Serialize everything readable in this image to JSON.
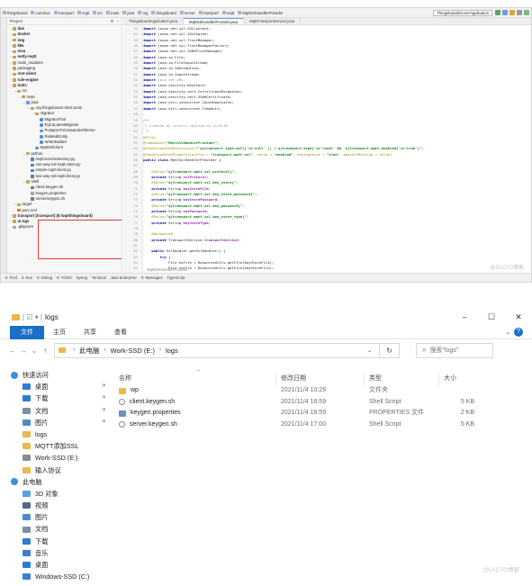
{
  "ide": {
    "breadcrumbs": [
      "thingsboard",
      "common",
      "transport",
      "mqtt",
      "src",
      "main",
      "java",
      "org",
      "thingsboard",
      "server",
      "transport",
      "mqtt",
      "MqttSslHandlerProvider"
    ],
    "run_config": "ThingsboardServerApplication",
    "project_label": "Project",
    "tabs": [
      "ThingsboardApplication.java",
      "MqttSslHandlerProvider.java",
      "MqttTransportService.java"
    ],
    "tree": [
      {
        "label": "dao",
        "depth": 0,
        "icon": "folder",
        "arrow": "›",
        "bold": true
      },
      {
        "label": "docker",
        "depth": 0,
        "icon": "folder",
        "arrow": "›",
        "bold": true
      },
      {
        "label": "img",
        "depth": 0,
        "icon": "folder",
        "arrow": "›",
        "bold": true
      },
      {
        "label": "k8s",
        "depth": 0,
        "icon": "folder",
        "arrow": "›",
        "bold": true
      },
      {
        "label": "msa",
        "depth": 0,
        "icon": "folder",
        "arrow": "›",
        "bold": true
      },
      {
        "label": "netty-mqtt",
        "depth": 0,
        "icon": "folder",
        "arrow": "›",
        "bold": true
      },
      {
        "label": "node_modules",
        "depth": 0,
        "icon": "folder",
        "arrow": "›",
        "bold": false
      },
      {
        "label": "packaging",
        "depth": 0,
        "icon": "folder",
        "arrow": "›",
        "bold": false
      },
      {
        "label": "rest-client",
        "depth": 0,
        "icon": "folder",
        "arrow": "›",
        "bold": true
      },
      {
        "label": "rule-engine",
        "depth": 0,
        "icon": "folder",
        "arrow": "›",
        "bold": true
      },
      {
        "label": "tools",
        "depth": 0,
        "icon": "folder",
        "arrow": "⌄",
        "bold": true
      },
      {
        "label": "src",
        "depth": 1,
        "icon": "folder",
        "arrow": "⌄",
        "bold": false
      },
      {
        "label": "main",
        "depth": 2,
        "icon": "folder",
        "arrow": "⌄",
        "bold": false
      },
      {
        "label": "java",
        "depth": 3,
        "icon": "src",
        "arrow": "⌄",
        "bold": false
      },
      {
        "label": "org.thingsboard.client.tools",
        "depth": 4,
        "icon": "folder",
        "arrow": "⌄",
        "bold": false
      },
      {
        "label": "migrator",
        "depth": 5,
        "icon": "folder",
        "arrow": "⌄",
        "bold": false
      },
      {
        "label": "MigratorTool",
        "depth": 6,
        "icon": "java",
        "arrow": "",
        "bold": false
      },
      {
        "label": "PgCaLatestMigrator",
        "depth": 6,
        "icon": "java",
        "arrow": "",
        "bold": false
      },
      {
        "label": "PostgresToCassandraTeleme",
        "depth": 6,
        "icon": "java",
        "arrow": "",
        "bold": false
      },
      {
        "label": "RelatedEntity",
        "depth": 6,
        "icon": "java",
        "arrow": "",
        "bold": false
      },
      {
        "label": "WriterBuilder",
        "depth": 6,
        "icon": "java",
        "arrow": "",
        "bold": false
      },
      {
        "label": "MqttSslClient",
        "depth": 5,
        "icon": "java",
        "arrow": "",
        "bold": false
      },
      {
        "label": "python",
        "depth": 3,
        "icon": "folder",
        "arrow": "⌄",
        "bold": false
      },
      {
        "label": "mqtt-send-telemetry.py",
        "depth": 4,
        "icon": "py",
        "arrow": "",
        "bold": false
      },
      {
        "label": "one-way-ssl-mqtt-client.py",
        "depth": 4,
        "icon": "py",
        "arrow": "",
        "bold": false
      },
      {
        "label": "simple-mqtt-client.py",
        "depth": 4,
        "icon": "py",
        "arrow": "",
        "bold": false
      },
      {
        "label": "two-way-ssl-mqtt-client.py",
        "depth": 4,
        "icon": "py",
        "arrow": "",
        "bold": false
      },
      {
        "label": "shell",
        "depth": 3,
        "icon": "folder",
        "arrow": "⌄",
        "bold": false
      },
      {
        "label": "client.keygen.sh",
        "depth": 4,
        "icon": "sh",
        "arrow": "",
        "bold": false
      },
      {
        "label": "keygen.properties",
        "depth": 4,
        "icon": "prop",
        "arrow": "",
        "bold": false
      },
      {
        "label": "server.keygen.sh",
        "depth": 4,
        "icon": "sh",
        "arrow": "",
        "bold": false
      },
      {
        "label": "target",
        "depth": 1,
        "icon": "folder",
        "arrow": "›",
        "bold": false
      },
      {
        "label": "pom.xml",
        "depth": 1,
        "icon": "xml",
        "arrow": "",
        "bold": false
      },
      {
        "label": "transport [transport] (E:\\wp\\thingsboard)",
        "depth": 0,
        "icon": "folder",
        "arrow": "›",
        "bold": true
      },
      {
        "label": "ui-ngx",
        "depth": 0,
        "icon": "folder",
        "arrow": "›",
        "bold": true
      },
      {
        "label": ".gitignore",
        "depth": 0,
        "icon": "prop",
        "arrow": "",
        "bold": false
      }
    ],
    "code_lines": [
      {
        "n": "43",
        "parts": [
          [
            "k",
            "import "
          ],
          [
            "t",
            "javax.net.ssl.SSLContext;"
          ]
        ]
      },
      {
        "n": "44",
        "parts": [
          [
            "k",
            "import "
          ],
          [
            "t",
            "javax.net.ssl.SSLEngine;"
          ]
        ]
      },
      {
        "n": "45",
        "parts": [
          [
            "k",
            "import "
          ],
          [
            "t",
            "javax.net.ssl.TrustManager;"
          ]
        ]
      },
      {
        "n": "46",
        "parts": [
          [
            "k",
            "import "
          ],
          [
            "t",
            "javax.net.ssl.TrustManagerFactory;"
          ]
        ]
      },
      {
        "n": "47",
        "parts": [
          [
            "k",
            "import "
          ],
          [
            "t",
            "javax.net.ssl.X509TrustManager;"
          ]
        ]
      },
      {
        "n": "48",
        "parts": [
          [
            "k",
            "import "
          ],
          [
            "t",
            "java.io.File;"
          ]
        ]
      },
      {
        "n": "49",
        "parts": [
          [
            "k",
            "import "
          ],
          [
            "t",
            "java.io.FileInputStream;"
          ]
        ]
      },
      {
        "n": "50",
        "parts": [
          [
            "k",
            "import "
          ],
          [
            "t",
            "java.io.IOException;"
          ]
        ]
      },
      {
        "n": "51",
        "parts": [
          [
            "k",
            "import "
          ],
          [
            "t",
            "java.io.InputStream;"
          ]
        ]
      },
      {
        "n": "52",
        "parts": [
          [
            "k",
            "import "
          ],
          [
            "c",
            "java.net.URL;"
          ]
        ]
      },
      {
        "n": "53",
        "parts": [
          [
            "k",
            "import "
          ],
          [
            "t",
            "java.security.KeyStore;"
          ]
        ]
      },
      {
        "n": "54",
        "parts": [
          [
            "k",
            "import "
          ],
          [
            "t",
            "java.security.cert.CertificateException;"
          ]
        ]
      },
      {
        "n": "55",
        "parts": [
          [
            "k",
            "import "
          ],
          [
            "t",
            "java.security.cert.X509Certificate;"
          ]
        ]
      },
      {
        "n": "56",
        "parts": [
          [
            "k",
            "import "
          ],
          [
            "t",
            "java.util.concurrent.CountDownLatch;"
          ]
        ]
      },
      {
        "n": "57",
        "parts": [
          [
            "k",
            "import "
          ],
          [
            "t",
            "java.util.concurrent.TimeUnit;"
          ]
        ]
      },
      {
        "n": "58",
        "parts": [
          [
            "t",
            ""
          ]
        ]
      },
      {
        "n": "59",
        "parts": [
          [
            "c",
            "/**"
          ]
        ]
      },
      {
        "n": "60",
        "parts": [
          [
            "c",
            " * Created by valerii.sosliuk on 11/6/16."
          ]
        ]
      },
      {
        "n": "61",
        "parts": [
          [
            "c",
            " */"
          ]
        ]
      },
      {
        "n": "62",
        "parts": [
          [
            "a",
            "@Slf4j"
          ]
        ]
      },
      {
        "n": "63",
        "parts": [
          [
            "a",
            "@Component("
          ],
          [
            "s",
            "\"MqttSslHandlerProvider\""
          ],
          [
            "a",
            ")"
          ]
        ]
      },
      {
        "n": "64",
        "parts": [
          [
            "a",
            "@ConditionalOnExpression("
          ],
          [
            "s",
            "\"'${transport.type:null}'=='null' || ('${transport.type}'=='local' && '${transport.mqtt.enabled}'=='true')\""
          ],
          [
            "a",
            ")"
          ]
        ]
      },
      {
        "n": "65",
        "parts": [
          [
            "a",
            "@ConditionalOnProperty(prefix = "
          ],
          [
            "s",
            "\"transport.mqtt.ssl\""
          ],
          [
            "a",
            ", value = "
          ],
          [
            "s",
            "\"enabled\""
          ],
          [
            "a",
            ", havingValue = "
          ],
          [
            "s",
            "\"true\""
          ],
          [
            "a",
            ", matchIfMissing = false)"
          ]
        ]
      },
      {
        "n": "66",
        "parts": [
          [
            "k",
            "public class "
          ],
          [
            "t",
            "MqttSslHandlerProvider {"
          ]
        ]
      },
      {
        "n": "67",
        "parts": [
          [
            "t",
            ""
          ]
        ]
      },
      {
        "n": "68",
        "parts": [
          [
            "a",
            "    @Value("
          ],
          [
            "s",
            "\"${transport.mqtt.ssl.protocol}\""
          ],
          [
            "a",
            ")"
          ]
        ]
      },
      {
        "n": "69",
        "parts": [
          [
            "k",
            "    private "
          ],
          [
            "t",
            "String "
          ],
          [
            "f",
            "sslProtocol"
          ],
          [
            "t",
            ";"
          ]
        ]
      },
      {
        "n": "70",
        "parts": [
          [
            "a",
            "    @Value("
          ],
          [
            "s",
            "\"${transport.mqtt.ssl.key_store}\""
          ],
          [
            "a",
            ")"
          ]
        ]
      },
      {
        "n": "71",
        "parts": [
          [
            "k",
            "    private "
          ],
          [
            "t",
            "String "
          ],
          [
            "f",
            "keyStoreFile"
          ],
          [
            "t",
            ";"
          ]
        ]
      },
      {
        "n": "72",
        "parts": [
          [
            "a",
            "    @Value("
          ],
          [
            "s",
            "\"${transport.mqtt.ssl.key_store_password}\""
          ],
          [
            "a",
            ")"
          ]
        ]
      },
      {
        "n": "73",
        "parts": [
          [
            "k",
            "    private "
          ],
          [
            "t",
            "String "
          ],
          [
            "f",
            "keyStorePassword"
          ],
          [
            "t",
            ";"
          ]
        ]
      },
      {
        "n": "74",
        "parts": [
          [
            "a",
            "    @Value("
          ],
          [
            "s",
            "\"${transport.mqtt.ssl.key_password}\""
          ],
          [
            "a",
            ")"
          ]
        ]
      },
      {
        "n": "75",
        "parts": [
          [
            "k",
            "    private "
          ],
          [
            "t",
            "String "
          ],
          [
            "f",
            "keyPassword"
          ],
          [
            "t",
            ";"
          ]
        ]
      },
      {
        "n": "76",
        "parts": [
          [
            "a",
            "    @Value("
          ],
          [
            "s",
            "\"${transport.mqtt.ssl.key_store_type}\""
          ],
          [
            "a",
            ")"
          ]
        ]
      },
      {
        "n": "77",
        "parts": [
          [
            "k",
            "    private "
          ],
          [
            "t",
            "String "
          ],
          [
            "f",
            "keyStoreType"
          ],
          [
            "t",
            ";"
          ]
        ]
      },
      {
        "n": "78",
        "parts": [
          [
            "t",
            ""
          ]
        ]
      },
      {
        "n": "79",
        "parts": [
          [
            "a",
            "    @Autowired"
          ]
        ]
      },
      {
        "n": "80",
        "parts": [
          [
            "k",
            "    private "
          ],
          [
            "t",
            "TransportService "
          ],
          [
            "f",
            "transportService"
          ],
          [
            "t",
            ";"
          ]
        ]
      },
      {
        "n": "81",
        "parts": [
          [
            "t",
            ""
          ]
        ]
      },
      {
        "n": "82",
        "parts": [
          [
            "k",
            "    public "
          ],
          [
            "t",
            "SslHandler getSslHandler() {"
          ]
        ]
      },
      {
        "n": "83",
        "parts": [
          [
            "k",
            "        try "
          ],
          [
            "t",
            "{"
          ]
        ]
      },
      {
        "n": "84",
        "parts": [
          [
            "t",
            "            File ksFile = ResourceUtils.getFile(keyStoreFile);"
          ]
        ]
      },
      {
        "n": "85",
        "parts": [
          [
            "t",
            "            File tsFile = ResourceUtils.getFile(keyStoreFile);"
          ]
        ]
      }
    ],
    "editor_footer": "MqttSslHandlerProvider",
    "bottom_bar": [
      "6: Find",
      "4: Run",
      "5: Debug",
      "6: TODO",
      "Spring",
      "Terminal",
      "Java Enterprise",
      "0: Messages",
      "TypeScript"
    ],
    "watermark": "@51CTO博客"
  },
  "explorer": {
    "title": "logs",
    "ribbon_tabs": {
      "file": "文件",
      "home": "主页",
      "share": "共享",
      "view": "查看"
    },
    "window_buttons": {
      "minimize": "–",
      "maximize": "☐",
      "close": "✕"
    },
    "address": {
      "pc": "此电脑",
      "drive": "Work-SSD (E:)",
      "folder": "logs"
    },
    "search_placeholder": "搜索\"logs\"",
    "columns": {
      "name": "名称",
      "date": "修改日期",
      "type": "类型",
      "size": "大小"
    },
    "files": [
      {
        "name": "wp",
        "date": "2021/11/4 10:29",
        "type": "文件夹",
        "size": "",
        "icon": "folder"
      },
      {
        "name": "client.keygen.sh",
        "date": "2021/11/4 16:59",
        "type": "Shell Script",
        "size": "5 KB",
        "icon": "shell"
      },
      {
        "name": "keygen.properties",
        "date": "2021/11/4 16:59",
        "type": "PROPERTIES 文件",
        "size": "2 KB",
        "icon": "prop"
      },
      {
        "name": "server.keygen.sh",
        "date": "2021/11/4 17:00",
        "type": "Shell Script",
        "size": "5 KB",
        "icon": "shell"
      }
    ],
    "nav": [
      {
        "label": "快速访问",
        "kind": "top",
        "color": "#3d8fe0",
        "pin": false
      },
      {
        "label": "桌面",
        "kind": "sub",
        "color": "#2f7bd3",
        "pin": true
      },
      {
        "label": "下载",
        "kind": "sub",
        "color": "#2f7bd3",
        "pin": true
      },
      {
        "label": "文档",
        "kind": "sub",
        "color": "#7c8fa8",
        "pin": true
      },
      {
        "label": "图片",
        "kind": "sub",
        "color": "#4e8bc8",
        "pin": true
      },
      {
        "label": "logs",
        "kind": "sub",
        "color": "#e9b94f",
        "pin": false
      },
      {
        "label": "MQTT添加SSL",
        "kind": "sub",
        "color": "#e9b94f",
        "pin": false
      },
      {
        "label": "Work-SSD (E:)",
        "kind": "sub",
        "color": "#8c8c8c",
        "pin": false
      },
      {
        "label": "输入协议",
        "kind": "sub",
        "color": "#e9b94f",
        "pin": false
      },
      {
        "label": "此电脑",
        "kind": "top",
        "color": "#3d8fe0",
        "pin": false
      },
      {
        "label": "3D 对象",
        "kind": "sub",
        "color": "#5aa0e0",
        "pin": false
      },
      {
        "label": "视频",
        "kind": "sub",
        "color": "#4f6a86",
        "pin": false
      },
      {
        "label": "图片",
        "kind": "sub",
        "color": "#4e8bc8",
        "pin": false
      },
      {
        "label": "文档",
        "kind": "sub",
        "color": "#7c8fa8",
        "pin": false
      },
      {
        "label": "下载",
        "kind": "sub",
        "color": "#2f7bd3",
        "pin": false
      },
      {
        "label": "音乐",
        "kind": "sub",
        "color": "#3a7fd0",
        "pin": false
      },
      {
        "label": "桌面",
        "kind": "sub",
        "color": "#2f7bd3",
        "pin": false
      },
      {
        "label": "Windows-SSD (C:)",
        "kind": "sub",
        "color": "#3a7fd0",
        "pin": false
      }
    ],
    "watermark": "@51CTO博客"
  }
}
